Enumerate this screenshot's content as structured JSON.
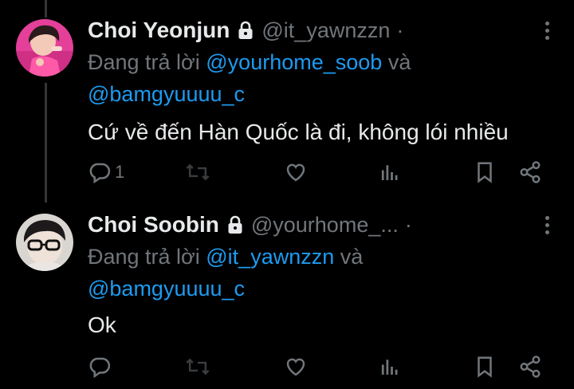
{
  "tweets": [
    {
      "display_name": "Choi Yeonjun",
      "handle": "@it_yawnzzn",
      "separator": "·",
      "reply_prefix": "Đang trả lời ",
      "reply_mention_1": "@yourhome_soob",
      "reply_joiner": " và",
      "reply_mention_2": "@bamgyuuuu_c",
      "text": "Cứ về đến Hàn Quốc là đi, không lói nhiều",
      "reply_count": "1"
    },
    {
      "display_name": "Choi Soobin",
      "handle": "@yourhome_...",
      "separator": "·",
      "reply_prefix": "Đang trả lời ",
      "reply_mention_1": "@it_yawnzzn",
      "reply_joiner": " và",
      "reply_mention_2": "@bamgyuuuu_c",
      "text": "Ok",
      "reply_count": ""
    }
  ],
  "icons": {
    "lock": "lock-icon",
    "reply": "reply-icon",
    "retweet": "retweet-icon",
    "like": "heart-icon",
    "views": "views-icon",
    "bookmark": "bookmark-icon",
    "share": "share-icon",
    "more": "more-icon"
  },
  "colors": {
    "background": "#000000",
    "text": "#e7e9ea",
    "muted": "#71767b",
    "mention": "#1d9bf0",
    "thread_line": "#333639"
  }
}
